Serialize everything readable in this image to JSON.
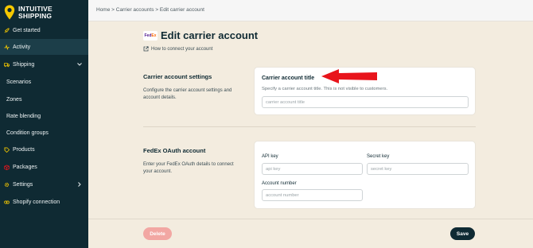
{
  "brand": {
    "line1": "INTUITIVE",
    "line2": "SHIPPING"
  },
  "sidebar": {
    "items": [
      {
        "label": "Get started",
        "icon": "rocket-icon"
      },
      {
        "label": "Activity",
        "icon": "activity-icon"
      },
      {
        "label": "Shipping",
        "icon": "truck-icon"
      },
      {
        "label": "Scenarios"
      },
      {
        "label": "Zones"
      },
      {
        "label": "Rate blending"
      },
      {
        "label": "Condition groups"
      },
      {
        "label": "Products",
        "icon": "tag-icon"
      },
      {
        "label": "Packages",
        "icon": "package-icon"
      },
      {
        "label": "Settings",
        "icon": "gear-icon"
      },
      {
        "label": "Shopify connection",
        "icon": "link-icon"
      }
    ],
    "active_item": "Activity"
  },
  "breadcrumb": {
    "home": "Home",
    "sep1": ">",
    "carrier_accounts": "Carrier accounts",
    "sep2": ">",
    "current": "Edit carrier account"
  },
  "page": {
    "title": "Edit carrier account",
    "logo_fe": "Fed",
    "logo_ex": "Ex",
    "help_link": "How to connect your account"
  },
  "carrier_settings": {
    "section_title": "Carrier account settings",
    "section_desc": "Configure the carrier account settings and account details.",
    "card_title": "Carrier account title",
    "card_hint": "Specify a carrier account title. This is not visible to customers.",
    "title_placeholder": "carrier account title"
  },
  "oauth": {
    "section_title": "FedEx OAuth account",
    "section_desc": "Enter your FedEx OAuth details to connect your account.",
    "api_key_label": "API key",
    "api_key_placeholder": "api key",
    "secret_key_label": "Secret key",
    "secret_key_placeholder": "secret key",
    "account_number_label": "Account number",
    "account_number_placeholder": "account number"
  },
  "footer": {
    "delete_label": "Delete",
    "save_label": "Save"
  },
  "colors": {
    "sidebar": "#0f2a33",
    "accent": "#f5c800",
    "page_bg": "#f3ecdf",
    "delete": "#f2a7a3",
    "arrow": "#e8141b"
  }
}
